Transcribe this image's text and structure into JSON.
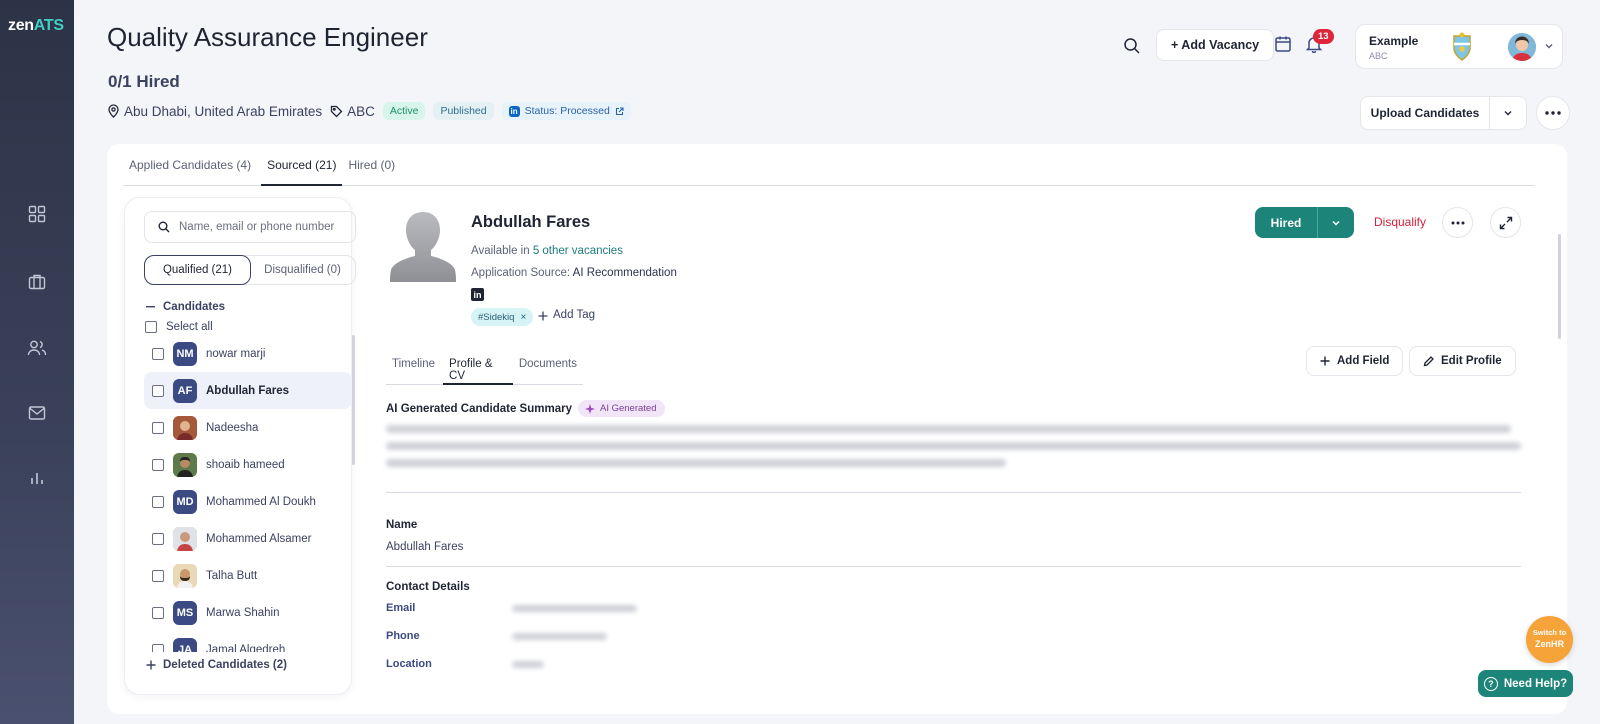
{
  "app": {
    "logo_main": "zen",
    "logo_accent": "ATS"
  },
  "header": {
    "title": "Quality Assurance Engineer",
    "hired_count": "0/1 Hired",
    "location": "Abu Dhabi, United Arab Emirates",
    "tag": "ABC",
    "badge_active": "Active",
    "badge_published": "Published",
    "badge_status": "Status: Processed"
  },
  "topbar": {
    "add_vacancy": "+ Add Vacancy",
    "notifications_count": "13",
    "account_name": "Example",
    "account_sub": "ABC",
    "upload_candidates": "Upload Candidates"
  },
  "tabs": [
    {
      "label": "Applied Candidates (4)"
    },
    {
      "label": "Sourced (21)"
    },
    {
      "label": "Hired (0)"
    }
  ],
  "candidate_panel": {
    "search_placeholder": "Name, email or phone number",
    "qualified": "Qualified (21)",
    "disqualified": "Disqualified (0)",
    "section_label": "Candidates",
    "select_all": "Select all",
    "deleted": "Deleted Candidates (2)",
    "candidates": [
      {
        "initials": "NM",
        "name": "nowar marji",
        "photo": false
      },
      {
        "initials": "AF",
        "name": "Abdullah Fares",
        "photo": false,
        "selected": true
      },
      {
        "initials": "",
        "name": "Nadeesha",
        "photo": true
      },
      {
        "initials": "",
        "name": "shoaib hameed",
        "photo": true
      },
      {
        "initials": "MD",
        "name": "Mohammed Al Doukh",
        "photo": false
      },
      {
        "initials": "",
        "name": "Mohammed Alsamer",
        "photo": true
      },
      {
        "initials": "",
        "name": "Talha Butt",
        "photo": true
      },
      {
        "initials": "MS",
        "name": "Marwa Shahin",
        "photo": false
      },
      {
        "initials": "JA",
        "name": "Jamal Alqedreh",
        "photo": false
      }
    ]
  },
  "detail": {
    "name": "Abdullah Fares",
    "available_prefix": "Available in ",
    "available_link": "5 other vacancies",
    "source_prefix": "Application Source: ",
    "source_value": "AI Recommendation",
    "tag": "#Sidekiq",
    "add_tag": "Add Tag",
    "hired_button": "Hired",
    "disqualify": "Disqualify",
    "tabs": [
      "Timeline",
      "Profile & CV",
      "Documents"
    ],
    "add_field": "Add Field",
    "edit_profile": "Edit Profile",
    "ai_summary_title": "AI Generated Candidate Summary",
    "ai_badge": "AI Generated",
    "name_label": "Name",
    "name_value": "Abdullah Fares",
    "contact_label": "Contact Details",
    "email_label": "Email",
    "phone_label": "Phone",
    "location_label": "Location"
  },
  "floating": {
    "switch_line1": "Switch to",
    "switch_line2": "ZenHR",
    "help": "Need Help?"
  },
  "colors": {
    "accent": "#1c8478",
    "danger": "#d0223a",
    "sidebar": "#2d3346"
  }
}
